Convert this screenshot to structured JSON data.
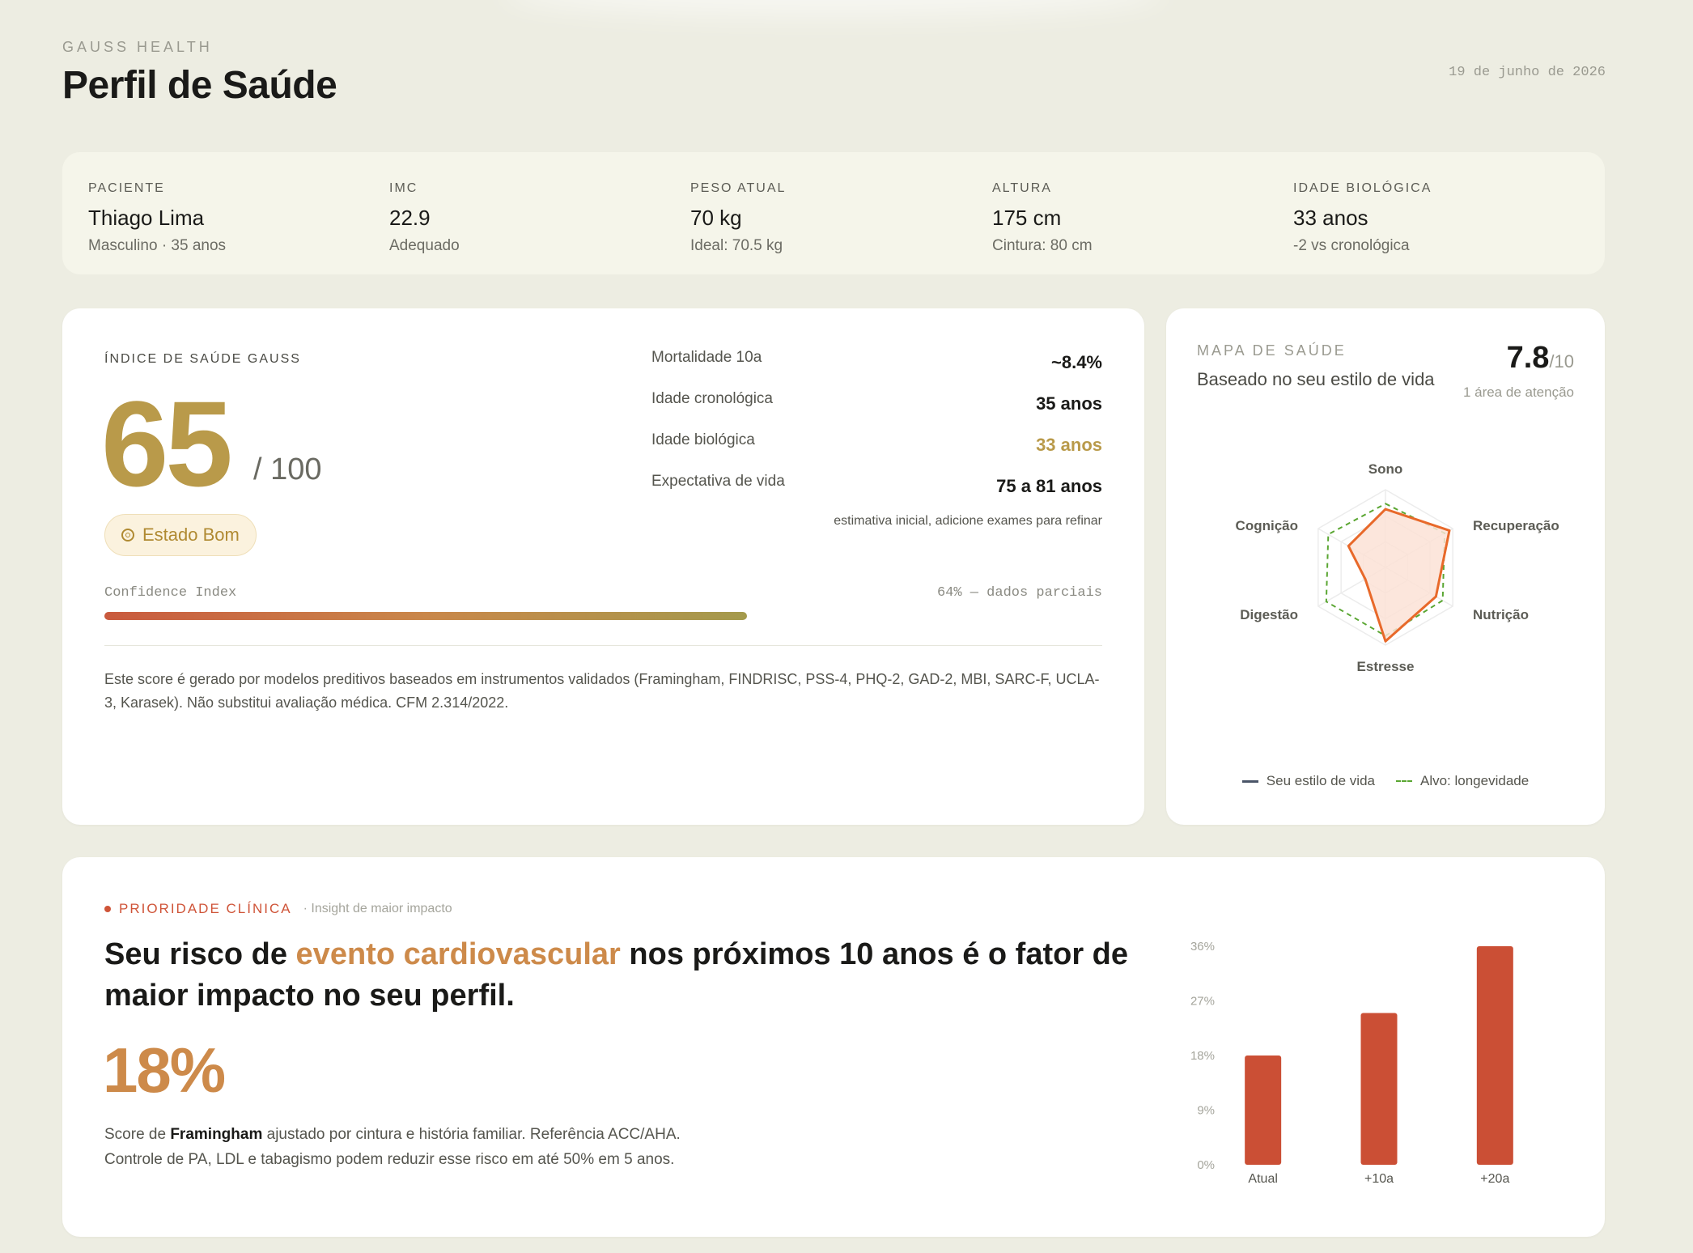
{
  "header": {
    "brand": "GAUSS HEALTH",
    "title": "Perfil de Saúde",
    "date": "19 de junho de 2026"
  },
  "patient_strip": [
    {
      "label": "PACIENTE",
      "value": "Thiago Lima",
      "sub": "Masculino · 35 anos"
    },
    {
      "label": "IMC",
      "value": "22.9",
      "sub": "Adequado"
    },
    {
      "label": "PESO ATUAL",
      "value": "70 kg",
      "sub": "Ideal: 70.5 kg"
    },
    {
      "label": "ALTURA",
      "value": "175 cm",
      "sub": "Cintura: 80 cm"
    },
    {
      "label": "IDADE BIOLÓGICA",
      "value": "33 anos",
      "sub": "-2 vs cronológica"
    }
  ],
  "score": {
    "label": "ÍNDICE DE SAÚDE GAUSS",
    "value": "65",
    "max": "/ 100",
    "status": "Estado Bom",
    "status_icon": "target-icon",
    "confidence_label": "Confidence Index",
    "confidence_note": "64% — dados parciais",
    "confidence_fraction": 0.64,
    "disclaimer": "Este score é gerado por modelos preditivos baseados em instrumentos validados (Framingham, FINDRISC, PSS-4, PHQ-2, GAD-2, MBI, SARC-F, UCLA-3, Karasek). Não substitui avaliação médica. CFM 2.314/2022.",
    "metrics": [
      {
        "label": "Mortalidade 10a",
        "value": "~8.4%"
      },
      {
        "label": "Idade cronológica",
        "value": "35 anos"
      },
      {
        "label": "Idade biológica",
        "value": "33 anos"
      },
      {
        "label": "Expectativa de vida",
        "value": "75 a 81 anos"
      }
    ],
    "metrics_footnote": "estimativa inicial, adicione exames para refinar"
  },
  "radar": {
    "label": "MAPA DE SAÚDE",
    "subtitle": "Baseado no seu estilo de vida",
    "score": "7.8",
    "score_den": "/10",
    "attention": "1 área de atenção",
    "axes": [
      "Sono",
      "Recuperação",
      "Nutrição",
      "Estresse",
      "Digestão",
      "Cognição"
    ],
    "series_user": [
      0.75,
      0.95,
      0.75,
      0.95,
      0.3,
      0.55
    ],
    "series_target": [
      0.82,
      0.88,
      0.85,
      0.88,
      0.88,
      0.85
    ],
    "legend_user": "Seu estilo de vida",
    "legend_target": "Alvo: longevidade",
    "colors": {
      "user": "#e8692a",
      "user_fill": "#fbe2d6",
      "target": "#5aa632",
      "legend_user": "#4a5568"
    }
  },
  "priority": {
    "tag": "PRIORIDADE CLÍNICA",
    "tag_sub": "· Insight de maior impacto",
    "headline_pre": "Seu risco de ",
    "headline_highlight": "evento cardiovascular",
    "headline_post": " nos próximos 10 anos é o fator de maior impacto no seu perfil.",
    "big_value": "18%",
    "desc_pre": "Score de ",
    "desc_bold": "Framingham",
    "desc_post": " ajustado por cintura e história familiar. Referência ACC/AHA. Controle de PA, LDL e tabagismo podem reduzir esse risco em até 50% em 5 anos."
  },
  "chart_data": {
    "type": "bar",
    "categories": [
      "Atual",
      "+10a",
      "+20a"
    ],
    "values": [
      18,
      25,
      36
    ],
    "ylim": [
      0,
      36
    ],
    "yticks": [
      "36%",
      "27%",
      "18%",
      "9%",
      "0%"
    ],
    "ytick_values": [
      36,
      27,
      18,
      9,
      0
    ],
    "color": "#cb4f35",
    "grid": false
  }
}
